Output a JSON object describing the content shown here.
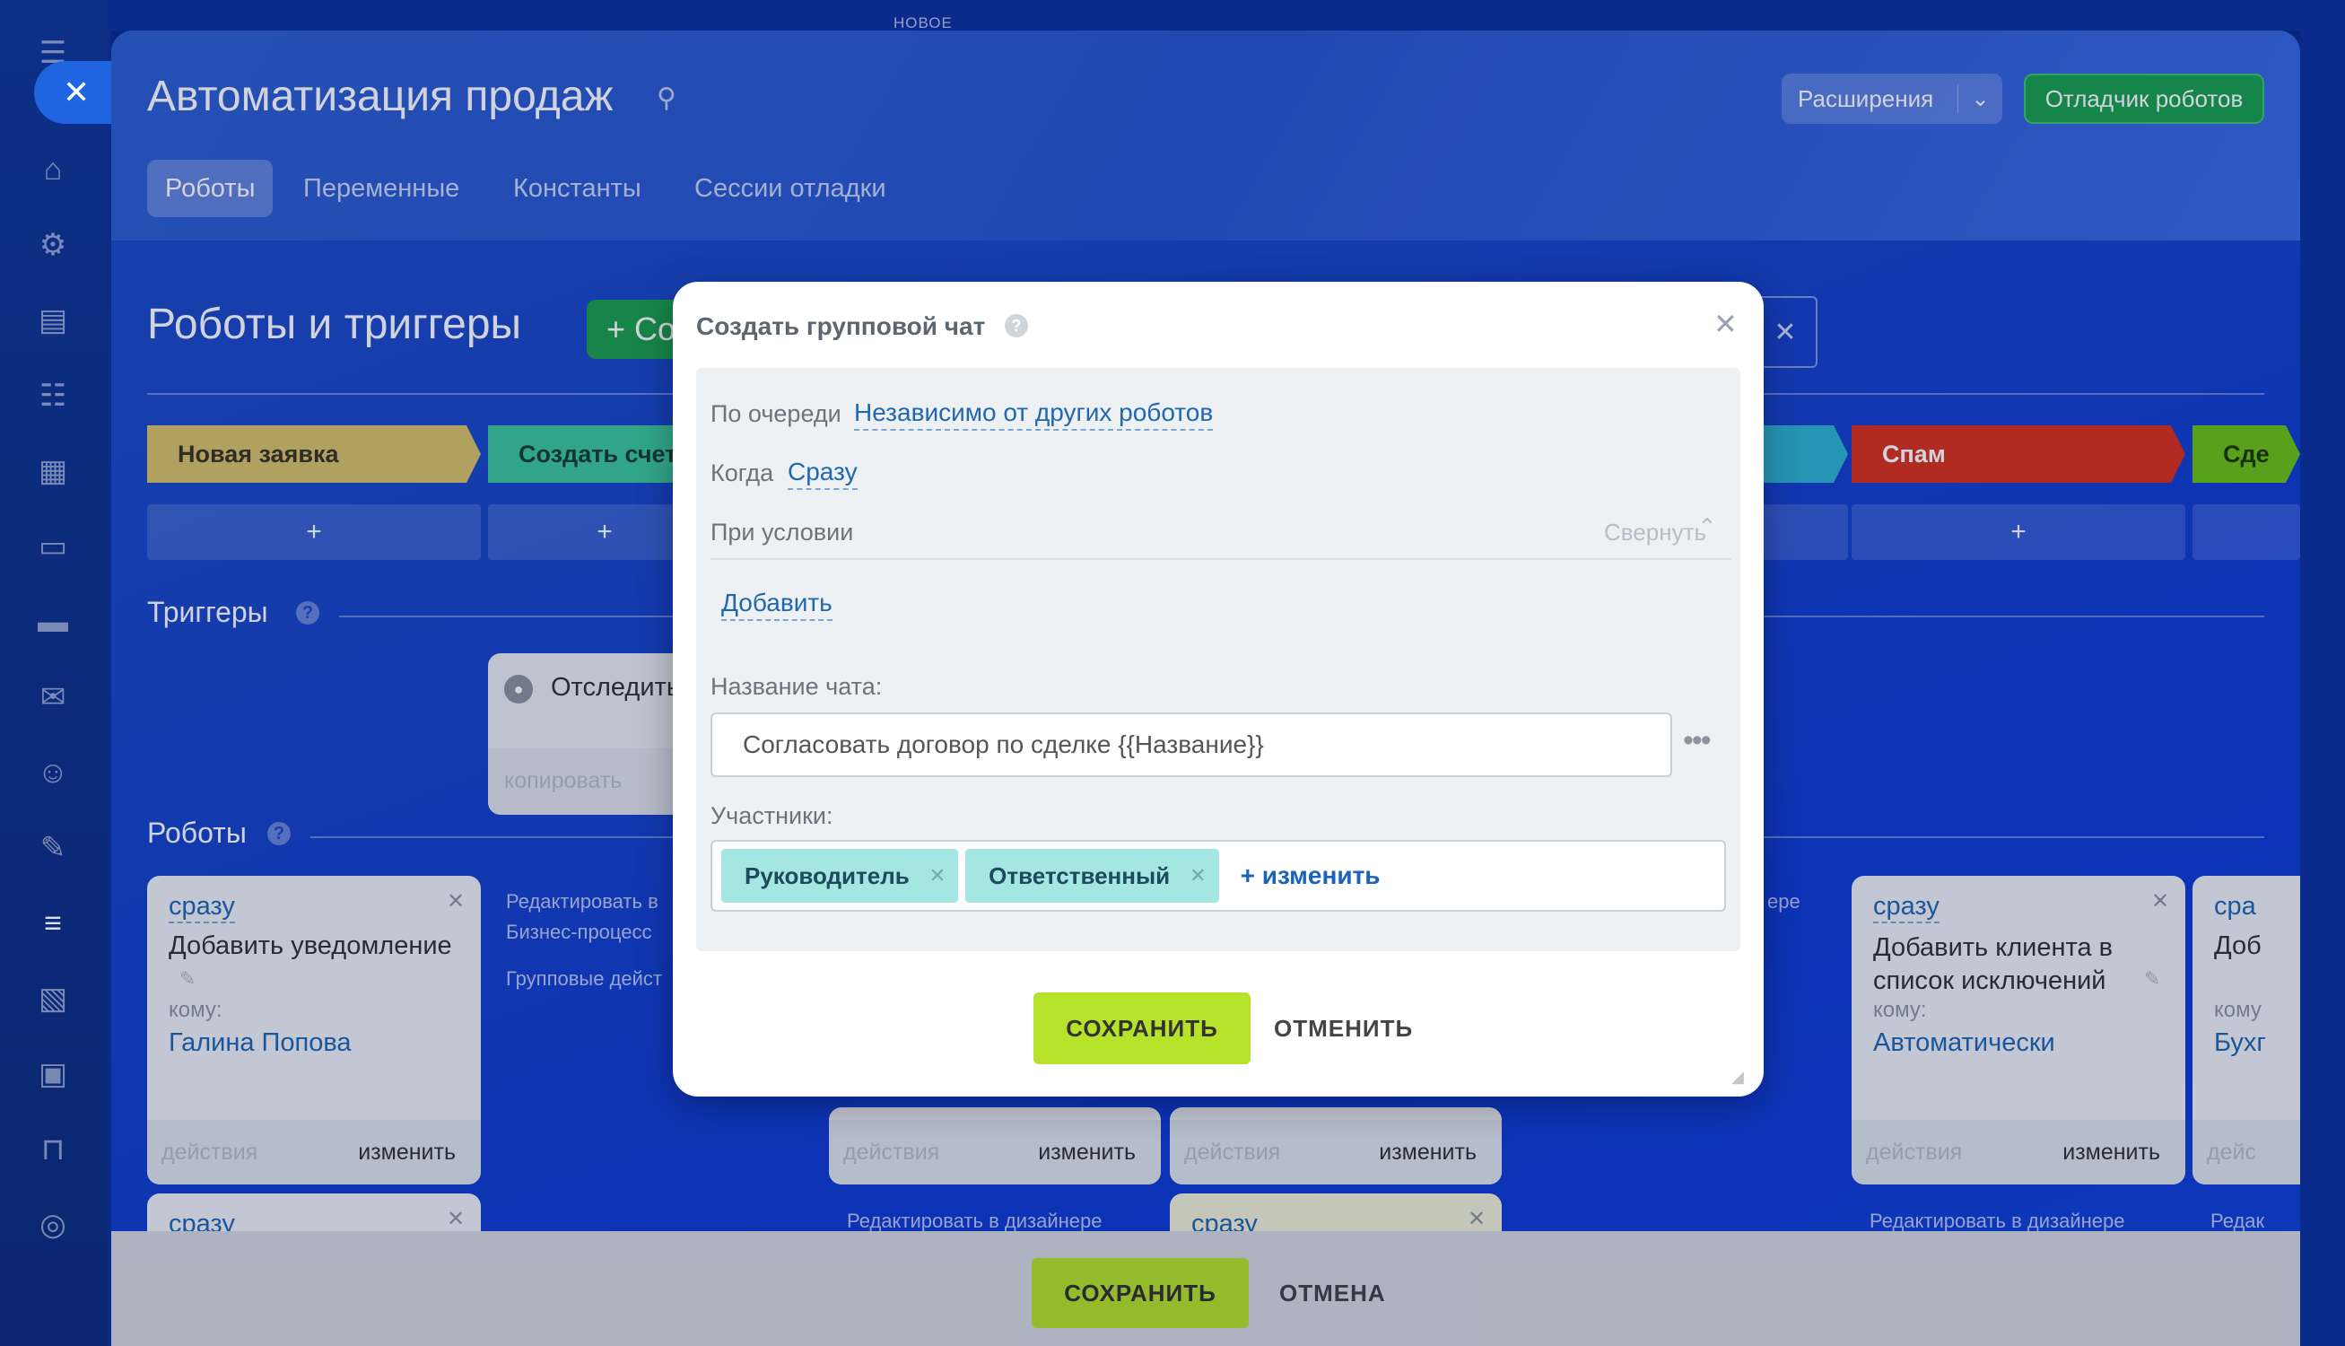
{
  "header": {
    "title": "Автоматизация продаж",
    "top_hint": "НОВОЕ",
    "extensions_label": "Расширения",
    "debugger_label": "Отладчик роботов"
  },
  "tabs": [
    {
      "label": "Роботы",
      "active": true
    },
    {
      "label": "Переменные",
      "active": false
    },
    {
      "label": "Константы",
      "active": false
    },
    {
      "label": "Сессии отладки",
      "active": false
    }
  ],
  "main": {
    "heading": "Роботы и триггеры",
    "add_label": "+ Со",
    "triggers_title": "Триггеры",
    "robots_title": "Роботы"
  },
  "stages": [
    {
      "label": "Новая заявка",
      "color": "#d8c36a"
    },
    {
      "label": "Создать счет",
      "color": "#3cc79a"
    },
    {
      "label": "",
      "color": "#2fb3cf"
    },
    {
      "label": "Спам",
      "color": "#d8321d"
    },
    {
      "label": "Сде",
      "color": "#6dc216"
    }
  ],
  "plus": "+",
  "trigger_card": {
    "title": "Отследить",
    "copy": "копировать"
  },
  "robot_cards": [
    {
      "when": "сразу",
      "title": "Добавить уведомление",
      "to_label": "кому:",
      "to_value": "Галина Попова",
      "actions": "действия",
      "change": "изменить"
    },
    {
      "when": "сразу",
      "title": "Добавить клиента в список исключений",
      "to_label": "кому:",
      "to_value": "Автоматически",
      "actions": "действия",
      "change": "изменить"
    },
    {
      "when": "сра",
      "title": "Доб",
      "to_label": "кому",
      "to_value": "Бухг",
      "actions": "дейс",
      "change": ""
    }
  ],
  "hidden_cards": [
    {
      "actions": "действия",
      "change": "изменить"
    },
    {
      "actions": "действия",
      "change": "изменить"
    }
  ],
  "side_texts": {
    "edit_in": "Редактировать в",
    "bp": "Бизнес-процесс",
    "group": "Групповые дейст",
    "edit_designer": "Редактировать в дизайнере",
    "edit_short": "Редак",
    "ere": "ере"
  },
  "row2": {
    "when1": "сразу",
    "when2": "сразу"
  },
  "modal": {
    "title": "Создать групповой чат",
    "queue_label": "По очереди",
    "queue_value": "Независимо от других роботов",
    "when_label": "Когда",
    "when_value": "Сразу",
    "condition_label": "При условии",
    "collapse_label": "Свернуть",
    "add_label": "Добавить",
    "chat_name_label": "Название чата:",
    "chat_name_value": "Согласовать договор по сделке {{Название}}",
    "members_label": "Участники:",
    "members": [
      "Руководитель",
      "Ответственный"
    ],
    "change_label": "+ изменить",
    "save": "СОХРАНИТЬ",
    "cancel": "ОТМЕНИТЬ"
  },
  "footer": {
    "save": "СОХРАНИТЬ",
    "cancel": "ОТМЕНА"
  }
}
